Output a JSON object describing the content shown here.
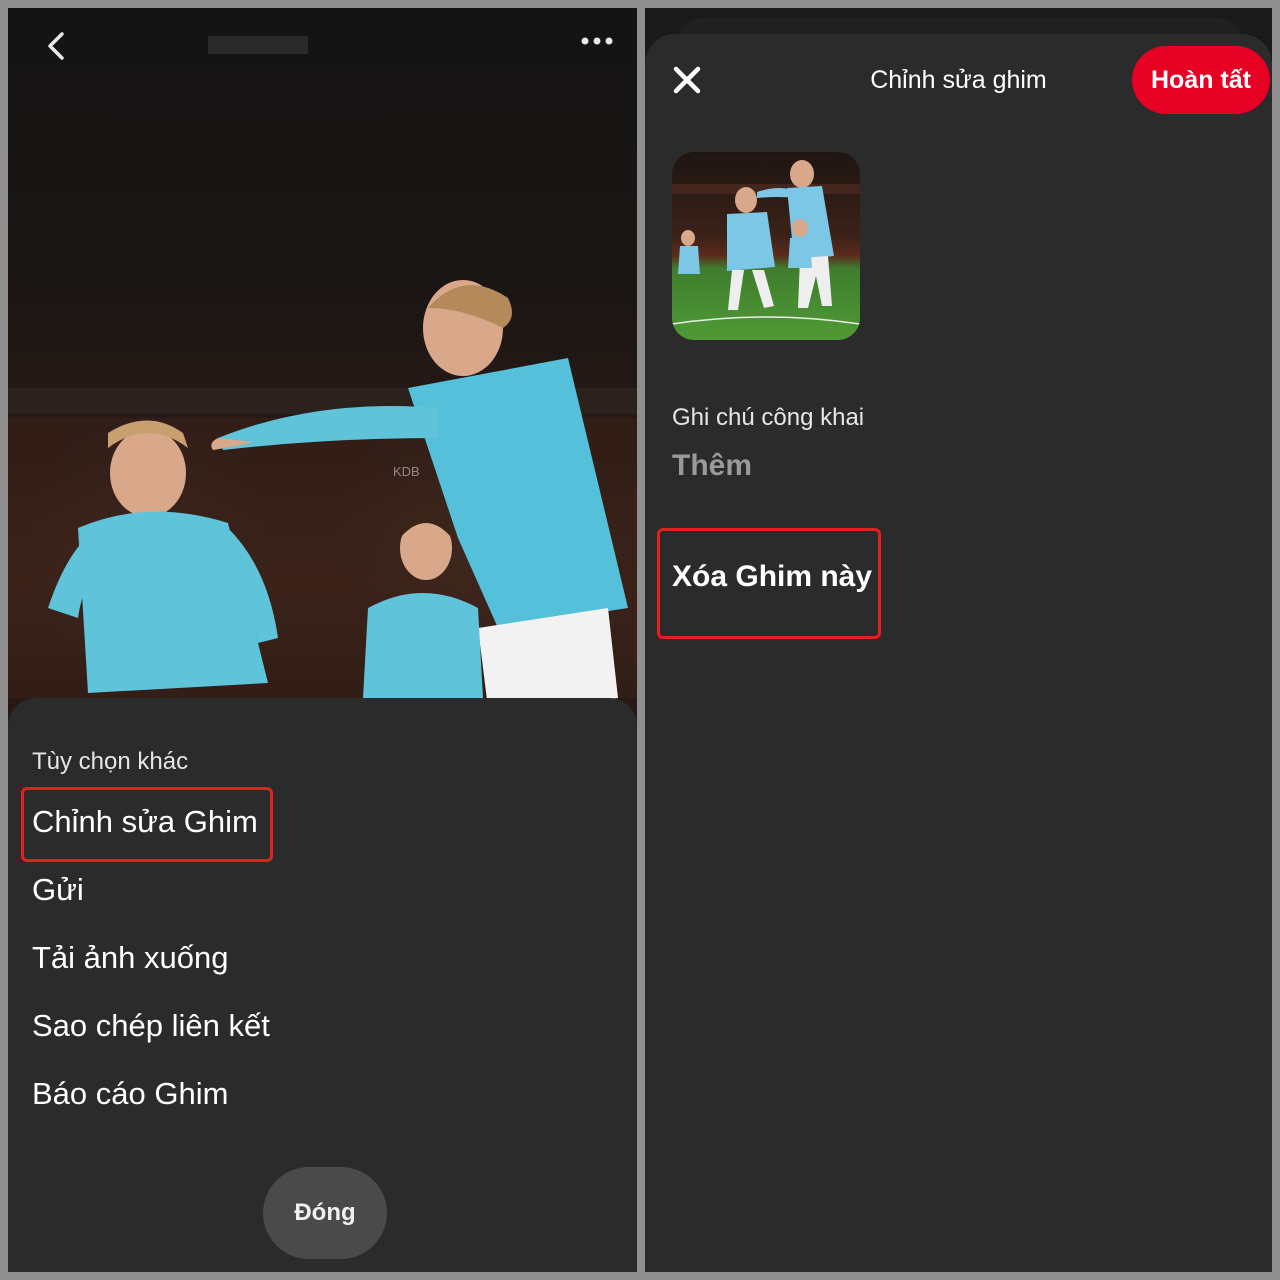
{
  "left_screen": {
    "options_sheet": {
      "title": "Tùy chọn khác",
      "items": [
        {
          "label": "Chỉnh sửa Ghim",
          "highlighted": true
        },
        {
          "label": "Gửi"
        },
        {
          "label": "Tải ảnh xuống"
        },
        {
          "label": "Sao chép liên kết"
        },
        {
          "label": "Báo cáo Ghim"
        }
      ],
      "close_label": "Đóng"
    },
    "icons": {
      "back": "chevron-left-icon",
      "more": "more-horizontal-icon"
    }
  },
  "right_screen": {
    "header": {
      "title": "Chỉnh sửa ghim",
      "done_label": "Hoàn tất",
      "close_icon": "close-icon"
    },
    "note": {
      "label": "Ghi chú công khai",
      "placeholder": "Thêm"
    },
    "delete_label": "Xóa Ghim này"
  },
  "colors": {
    "accent": "#e60023",
    "highlight_box": "#e0211f",
    "sheet_bg": "#2b2b2b",
    "jersey": "#5fbfd8"
  }
}
